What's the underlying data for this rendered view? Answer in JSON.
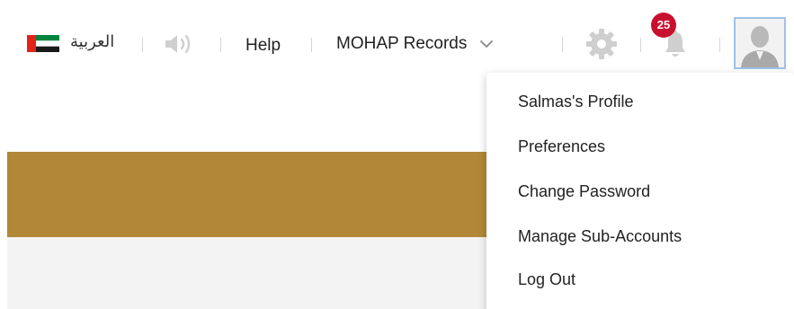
{
  "header": {
    "language_label": "العربية",
    "help_label": "Help",
    "records_label": "MOHAP Records",
    "notification_count": "25",
    "icons": {
      "flag": "uae-flag-icon",
      "speaker": "speaker-icon",
      "chevron": "chevron-down-icon",
      "settings": "gear-icon",
      "notifications": "bell-icon",
      "avatar": "user-avatar-icon"
    }
  },
  "user_menu": {
    "items": [
      {
        "label": "Salmas's Profile"
      },
      {
        "label": "Preferences"
      },
      {
        "label": "Change Password"
      },
      {
        "label": "Manage Sub-Accounts"
      },
      {
        "label": "Log Out"
      }
    ]
  },
  "colors": {
    "accent_gold": "#b28837",
    "badge_red": "#c8102e",
    "icon_gray": "#cfcfcf",
    "avatar_border": "#9fc2e8"
  }
}
